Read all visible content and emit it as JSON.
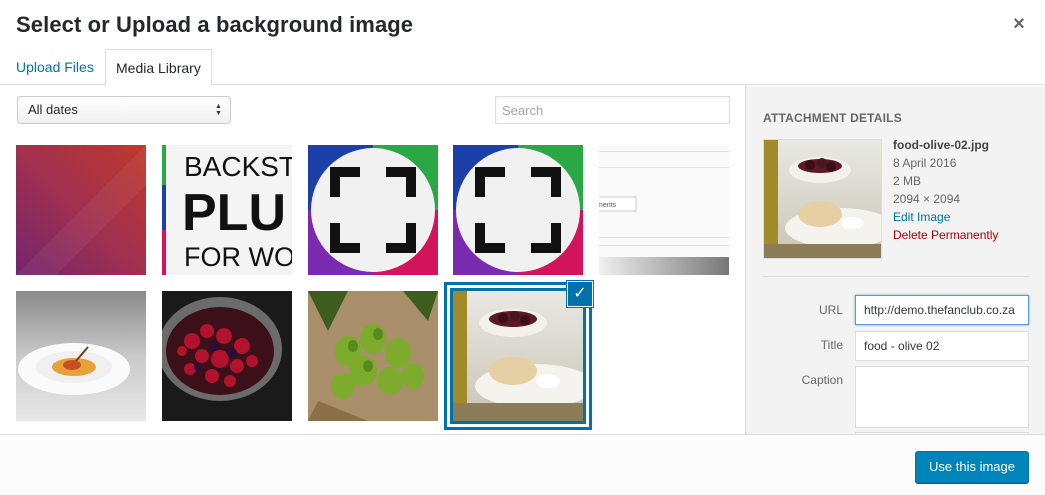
{
  "dialog": {
    "title": "Select or Upload a background image",
    "close_icon": "×"
  },
  "tabs": [
    {
      "label": "Upload Files"
    },
    {
      "label": "Media Library"
    }
  ],
  "toolbar": {
    "date_filter": "All dates",
    "search_placeholder": "Search"
  },
  "grid": {
    "items": [
      {
        "description": "gradient red purple"
      },
      {
        "description": "backstretch plus logo",
        "text_1": "BACKST",
        "text_2": "PLU",
        "text_3": "FOR WO"
      },
      {
        "description": "plugin icon fullscreen"
      },
      {
        "description": "plugin icon fullscreen"
      },
      {
        "description": "settings screenshot",
        "text_1": "ments"
      },
      {
        "description": "soup bowl"
      },
      {
        "description": "berries colander"
      },
      {
        "description": "figs"
      },
      {
        "description": "food olive",
        "selected": true
      }
    ],
    "checkmark_icon": "✓"
  },
  "attachment": {
    "heading": "Attachment Details",
    "filename": "food-olive-02.jpg",
    "date": "8 April 2016",
    "size": "2 MB",
    "dimensions": "2094 × 2094",
    "edit_label": "Edit Image",
    "delete_label": "Delete Permanently"
  },
  "fields": {
    "url_label": "URL",
    "url_value": "http://demo.thefanclub.co.za",
    "title_label": "Title",
    "title_value": "food - olive 02",
    "caption_label": "Caption",
    "caption_value": ""
  },
  "footer": {
    "button_label": "Use this image"
  },
  "colors": {
    "accent": "#0073aa",
    "button": "#0085ba",
    "delete": "#aa0000"
  }
}
